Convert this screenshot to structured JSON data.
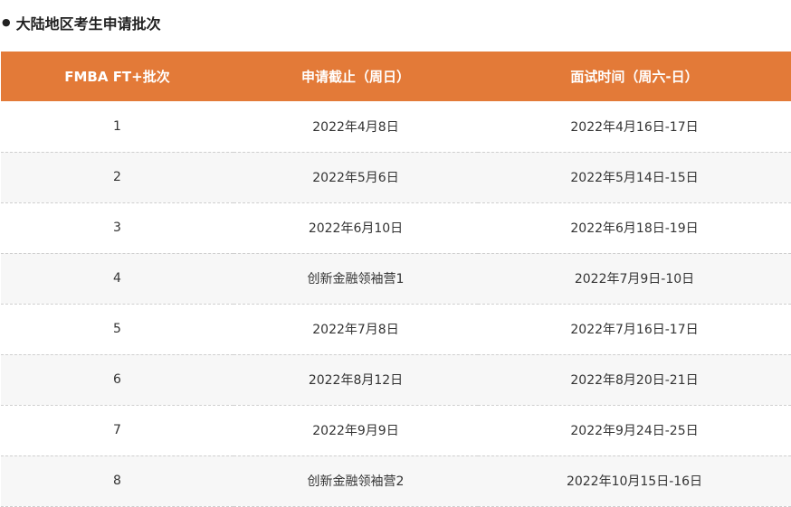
{
  "section": {
    "bullet": "●",
    "title": "大陆地区考生申请批次"
  },
  "colors": {
    "header_bg": "#e37a38",
    "header_text": "#ffffff",
    "alt_row_bg": "#f7f7f7"
  },
  "table": {
    "headers": [
      "FMBA FT+批次",
      "申请截止（周日）",
      "面试时间（周六-日）"
    ],
    "rows": [
      [
        "1",
        "2022年4月8日",
        "2022年4月16日-17日"
      ],
      [
        "2",
        "2022年5月6日",
        "2022年5月14日-15日"
      ],
      [
        "3",
        "2022年6月10日",
        "2022年6月18日-19日"
      ],
      [
        "4",
        "创新金融领袖营1",
        "2022年7月9日-10日"
      ],
      [
        "5",
        "2022年7月8日",
        "2022年7月16日-17日"
      ],
      [
        "6",
        "2022年8月12日",
        "2022年8月20日-21日"
      ],
      [
        "7",
        "2022年9月9日",
        "2022年9月24日-25日"
      ],
      [
        "8",
        "创新金融领袖营2",
        "2022年10月15日-16日"
      ]
    ]
  }
}
